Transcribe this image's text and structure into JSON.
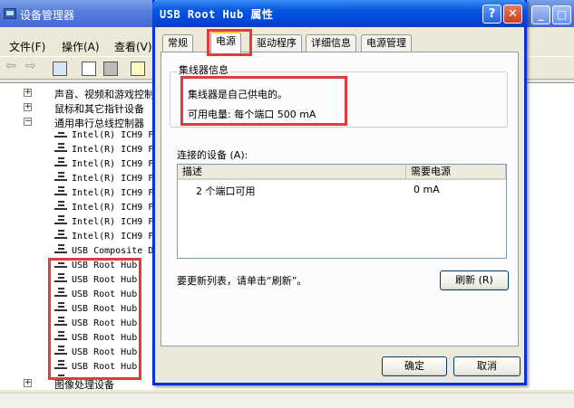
{
  "device_manager": {
    "title": "设备管理器",
    "menus": [
      "文件(F)",
      "操作(A)",
      "查看(V)"
    ],
    "tree": {
      "categories": [
        "声音、视频和游戏控制器",
        "鼠标和其它指针设备",
        "通用串行总线控制器",
        "图像处理设备"
      ],
      "controllers": [
        "Intel(R) ICH9 F",
        "Intel(R) ICH9 F",
        "Intel(R) ICH9 F",
        "Intel(R) ICH9 F",
        "Intel(R) ICH9 F",
        "Intel(R) ICH9 F",
        "Intel(R) ICH9 F",
        "Intel(R) ICH9 F"
      ],
      "composite": "USB Composite D",
      "root_hubs": [
        "USB Root Hub",
        "USB Root Hub",
        "USB Root Hub",
        "USB Root Hub",
        "USB Root Hub",
        "USB Root Hub",
        "USB Root Hub",
        "USB Root Hub"
      ]
    }
  },
  "dialog": {
    "title": "USB Root Hub 属性",
    "help_glyph": "?",
    "close_glyph": "✕",
    "tabs": [
      "常规",
      "电源",
      "驱动程序",
      "详细信息",
      "电源管理"
    ],
    "active_tab": "电源",
    "hub_group": {
      "title": "集线器信息",
      "self_powered": "集线器是自己供电的。",
      "available_power": "可用电量:  每个端口 500 mA"
    },
    "connected": {
      "label": "连接的设备 (A):",
      "columns": [
        "描述",
        "需要电源"
      ],
      "rows": [
        {
          "description": "2 个端口可用",
          "power": "0 mA"
        }
      ]
    },
    "refresh_hint": "要更新列表，请单击“刷新”。",
    "refresh_button": "刷新 (R)",
    "ok_button": "确定",
    "cancel_button": "取消"
  },
  "colors": {
    "highlight": "#e03c3c",
    "xp_title": "#0343d9"
  }
}
